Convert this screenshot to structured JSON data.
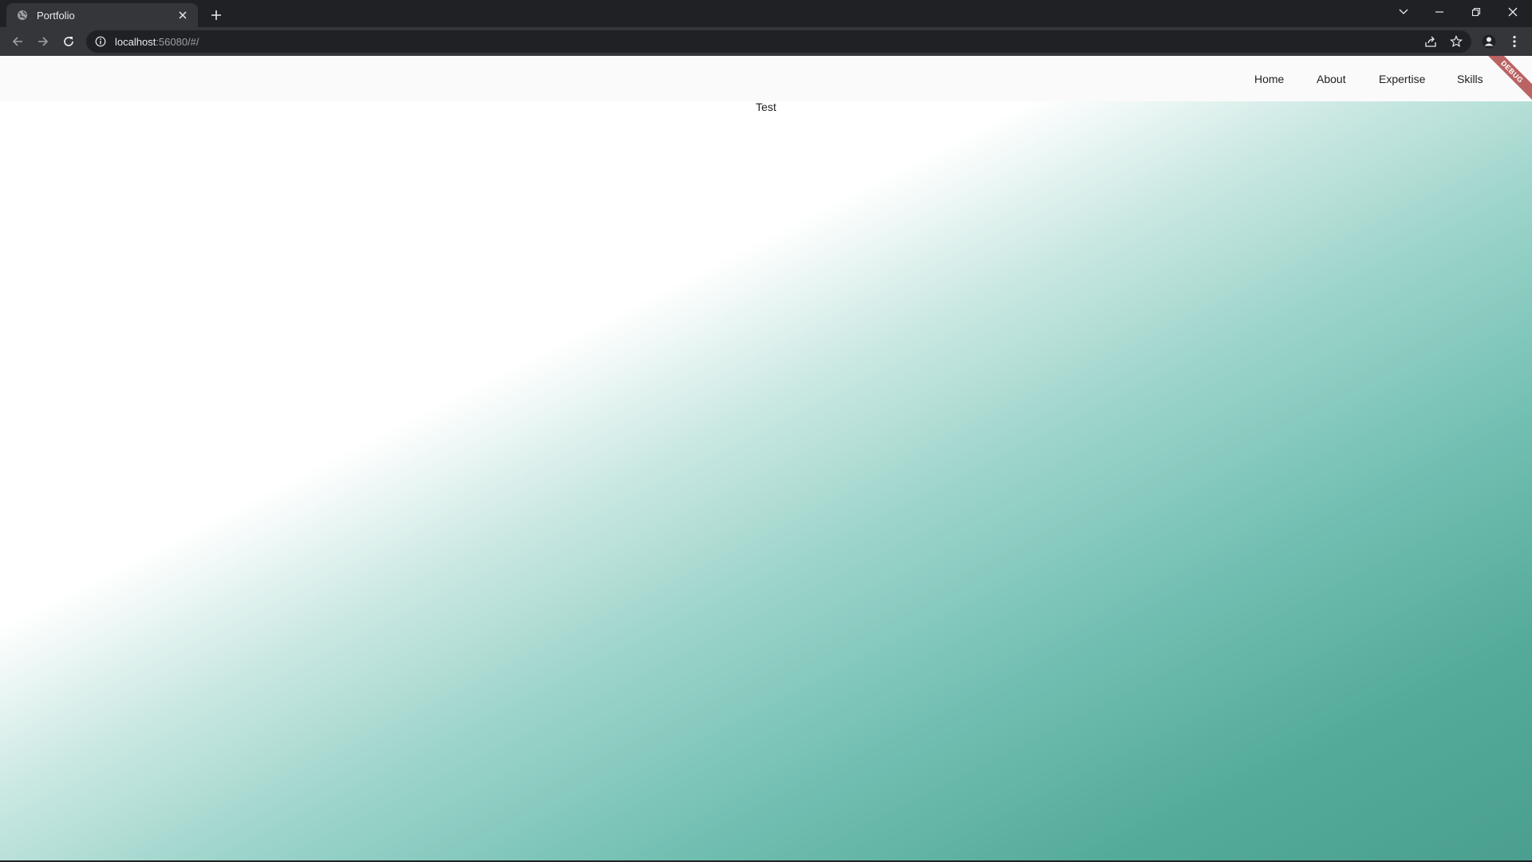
{
  "browser": {
    "tab": {
      "title": "Portfolio"
    },
    "address": {
      "host": "localhost",
      "rest": ":56080/#/"
    }
  },
  "app": {
    "nav": [
      {
        "label": "Home"
      },
      {
        "label": "About"
      },
      {
        "label": "Expertise"
      },
      {
        "label": "Skills"
      }
    ],
    "body_text": "Test",
    "debug_banner": "DEBUG"
  },
  "colors": {
    "gradient_start": "#ffffff",
    "gradient_end": "#4a9f8f",
    "nav_bg": "#fafafa",
    "browser_dark": "#202124",
    "browser_toolbar": "#35363a",
    "debug_banner": "#a02828"
  },
  "icons": {
    "favicon": "globe-icon",
    "tab_close": "close-icon",
    "new_tab": "plus-icon",
    "tab_search": "chevron-down-icon",
    "minimize": "minimize-icon",
    "restore": "restore-icon",
    "close_window": "close-icon",
    "back": "arrow-left-icon",
    "forward": "arrow-right-icon",
    "reload": "reload-icon",
    "site_info": "info-icon",
    "share": "share-icon",
    "bookmark": "star-icon",
    "profile": "profile-icon",
    "menu": "kebab-menu-icon"
  }
}
